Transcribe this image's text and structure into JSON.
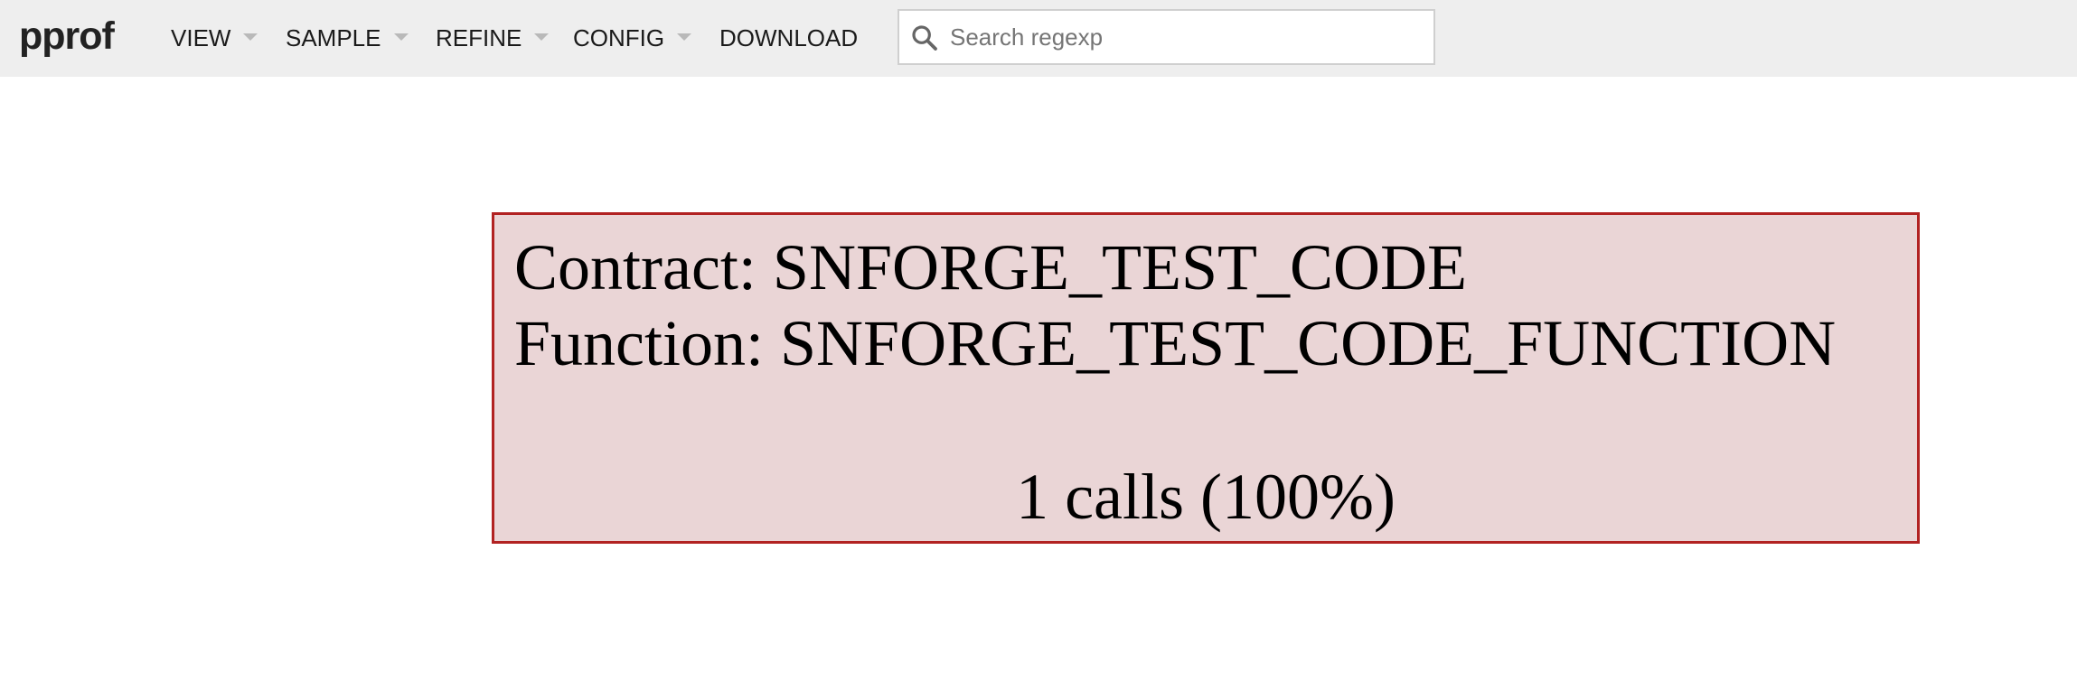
{
  "header": {
    "logo": "pprof",
    "menu": [
      {
        "label": "VIEW",
        "has_dropdown": true
      },
      {
        "label": "SAMPLE",
        "has_dropdown": true
      },
      {
        "label": "REFINE",
        "has_dropdown": true
      },
      {
        "label": "CONFIG",
        "has_dropdown": true
      },
      {
        "label": "DOWNLOAD",
        "has_dropdown": false
      }
    ],
    "search": {
      "icon": "search-icon",
      "placeholder": "Search regexp",
      "value": ""
    }
  },
  "graph": {
    "node": {
      "contract_line": "Contract: SNFORGE_TEST_CODE",
      "function_line": "Function: SNFORGE_TEST_CODE_FUNCTION",
      "calls_line": "1 calls (100%)",
      "fill_color": "#ead5d6",
      "border_color": "#b22222"
    }
  },
  "colors": {
    "header_bg": "#eeeeee",
    "page_bg": "#ffffff"
  }
}
